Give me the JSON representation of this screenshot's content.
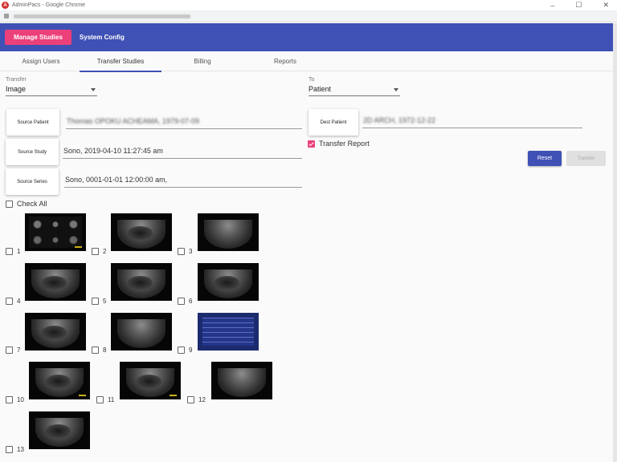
{
  "window": {
    "title": "AdminPacs - Google Chrome",
    "logo_letter": "A",
    "controls": [
      "–",
      "☐",
      "✕"
    ]
  },
  "app_bar": {
    "manage_label": "Manage Studies",
    "system_label": "System Config",
    "colors": {
      "bar": "#3f51b5",
      "manage": "#ec407a"
    }
  },
  "tabs": [
    {
      "label": "Assign Users"
    },
    {
      "label": "Transfer Studies",
      "active": true
    },
    {
      "label": "Billing"
    },
    {
      "label": "Reports"
    }
  ],
  "form": {
    "transfer_label": "Transfer",
    "transfer_value": "Image",
    "to_label": "To",
    "to_value": "Patient",
    "source_patient_btn": "Source Patient",
    "source_patient_value": "Thomas OPOKU ACHEAMA, 1979-07-09",
    "source_study_btn": "Source Study",
    "source_study_value": "Sono, 2019-04-10 11:27:45 am",
    "source_series_btn": "Source Series",
    "source_series_value": "Sono, 0001-01-01 12:00:00 am,",
    "dest_patient_btn": "Dest Patient",
    "dest_patient_value": "2D ARCH, 1972-12-22",
    "transfer_report_label": "Transfer Report",
    "transfer_report_checked": true,
    "reset_label": "Reset",
    "transfer_btn_label": "Transfer",
    "check_all_label": "Check All"
  },
  "images": [
    {
      "num": "1",
      "kind": "grid"
    },
    {
      "num": "2",
      "kind": "us"
    },
    {
      "num": "3",
      "kind": "us"
    },
    {
      "num": "4",
      "kind": "us"
    },
    {
      "num": "5",
      "kind": "us"
    },
    {
      "num": "6",
      "kind": "us"
    },
    {
      "num": "7",
      "kind": "us"
    },
    {
      "num": "8",
      "kind": "us"
    },
    {
      "num": "9",
      "kind": "table"
    },
    {
      "num": "10",
      "kind": "us"
    },
    {
      "num": "11",
      "kind": "us"
    },
    {
      "num": "12",
      "kind": "us"
    },
    {
      "num": "13",
      "kind": "us"
    }
  ]
}
